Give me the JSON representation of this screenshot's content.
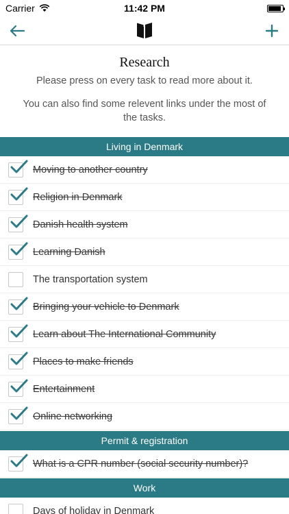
{
  "status_bar": {
    "carrier": "Carrier",
    "time": "11:42 PM",
    "battery_level": 0.92
  },
  "nav": {
    "back_icon": "arrow-left-icon",
    "center_icon": "book-icon",
    "add_icon": "plus-icon",
    "accent_color": "#2b7b86"
  },
  "header": {
    "title": "Research",
    "subtitle": "Please press on every task to read more about it.",
    "note": "You can also find some relevent links under the most of the tasks."
  },
  "sections": [
    {
      "title": "Living in Denmark",
      "tasks": [
        {
          "label": "Moving to another country",
          "done": true
        },
        {
          "label": "Religion in Denmark",
          "done": true
        },
        {
          "label": "Danish health system",
          "done": true
        },
        {
          "label": "Learning Danish",
          "done": true
        },
        {
          "label": "The transportation system",
          "done": false
        },
        {
          "label": "Bringing your vehicle to Denmark",
          "done": true
        },
        {
          "label": "Learn about The International Community",
          "done": true
        },
        {
          "label": "Places to make friends",
          "done": true
        },
        {
          "label": "Entertainment",
          "done": true
        },
        {
          "label": "Online networking",
          "done": true
        }
      ]
    },
    {
      "title": "Permit & registration",
      "tasks": [
        {
          "label": "What is a CPR number (social security number)?",
          "done": true
        }
      ]
    },
    {
      "title": "Work",
      "tasks": [
        {
          "label": "Days of holiday in Denmark",
          "done": false
        }
      ]
    }
  ],
  "colors": {
    "section_bg": "#2b7b86",
    "check": "#2b7b86"
  }
}
